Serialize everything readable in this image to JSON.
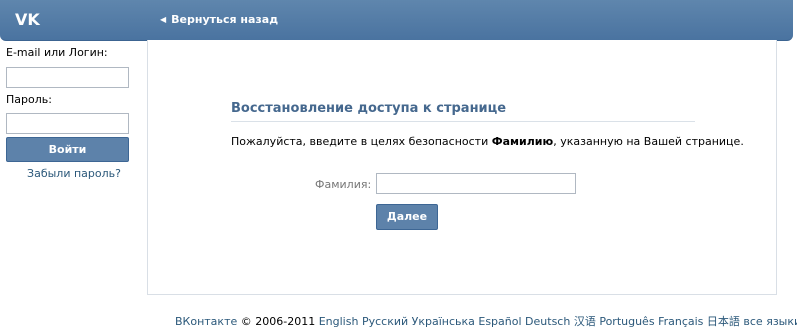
{
  "header": {
    "logo": "VK",
    "back_link": "Вернуться назад"
  },
  "sidebar": {
    "login_label": "E-mail или Логин:",
    "login_value": "",
    "password_label": "Пароль:",
    "password_value": "",
    "login_button": "Войти",
    "forgot_link": "Забыли пароль?"
  },
  "recovery": {
    "title": "Восстановление доступа к странице",
    "text_before": "Пожалуйста, введите в целях безопасности ",
    "text_bold": "Фамилию",
    "text_after": ", указанную на Вашей странице.",
    "surname_label": "Фамилия:",
    "surname_value": "",
    "next_button": "Далее"
  },
  "footer": {
    "site": "ВКонтакте",
    "copyright": "© 2006-2011",
    "languages": [
      "English",
      "Русский",
      "Українська",
      "Español",
      "Deutsch",
      "汉语",
      "Português",
      "Français",
      "日本語",
      "все языки »"
    ]
  },
  "colors": {
    "header_bg": "#5f86ad",
    "link": "#2b587a",
    "title": "#45688e",
    "button_bg": "#5d82aa"
  }
}
